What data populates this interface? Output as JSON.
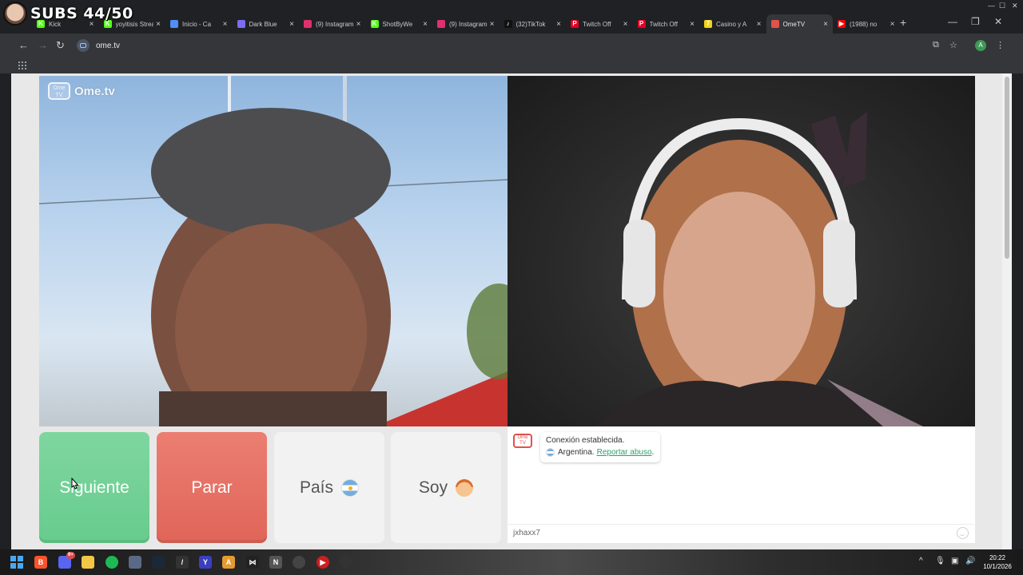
{
  "overlay": {
    "subs_text": "SUBS 44/50"
  },
  "browser": {
    "tabs": [
      {
        "label": "Kick",
        "icon": "kick-icon",
        "color": "#53fc18",
        "glyph": "K",
        "active": false
      },
      {
        "label": "yoyitisis Stream",
        "icon": "kick-icon",
        "color": "#53fc18",
        "glyph": "K",
        "active": false
      },
      {
        "label": "Inicio - Ca",
        "icon": "globe-icon",
        "color": "#4f8ef7",
        "glyph": "",
        "active": false
      },
      {
        "label": "Dark Blue",
        "icon": "shield-icon",
        "color": "#7c6cf0",
        "glyph": "",
        "active": false
      },
      {
        "label": "(9) Instagram",
        "icon": "instagram-icon",
        "color": "#e1306c",
        "glyph": "",
        "active": false
      },
      {
        "label": "ShotByWe",
        "icon": "kick-icon",
        "color": "#53fc18",
        "glyph": "K",
        "active": false
      },
      {
        "label": "(9) Instagram",
        "icon": "instagram-icon",
        "color": "#e1306c",
        "glyph": "",
        "active": false
      },
      {
        "label": "(32)TikTok",
        "icon": "tiktok-icon",
        "color": "#111111",
        "glyph": "♪",
        "active": false
      },
      {
        "label": "Twitch Off",
        "icon": "pinterest-icon",
        "color": "#e60023",
        "glyph": "P",
        "active": false
      },
      {
        "label": "Twitch Off",
        "icon": "pinterest-icon",
        "color": "#e60023",
        "glyph": "P",
        "active": false
      },
      {
        "label": "Casino y A",
        "icon": "casino-icon",
        "color": "#f2d21b",
        "glyph": "7",
        "active": false
      },
      {
        "label": "OmeTV",
        "icon": "ometv-icon",
        "color": "#e0524b",
        "glyph": "",
        "active": true
      },
      {
        "label": "(1988) no",
        "icon": "youtube-icon",
        "color": "#ff0000",
        "glyph": "▶",
        "active": false
      }
    ],
    "url": "ome.tv",
    "profile_initial": "A"
  },
  "ometv": {
    "logo_text": "Ome.tv",
    "logo_badge_top": "Ome",
    "logo_badge_bottom": "TV",
    "buttons": {
      "next": "Siguiente",
      "stop": "Parar",
      "country": "País",
      "gender": "Soy"
    },
    "chat": {
      "connection_status": "Conexión establecida.",
      "country": "Argentina.",
      "report_link": "Reportar abuso",
      "report_suffix": ".",
      "input_value": "jxhaxx7"
    }
  },
  "taskbar": {
    "time": "20:22",
    "date": "10/1/2026",
    "discord_badge": "9+"
  }
}
